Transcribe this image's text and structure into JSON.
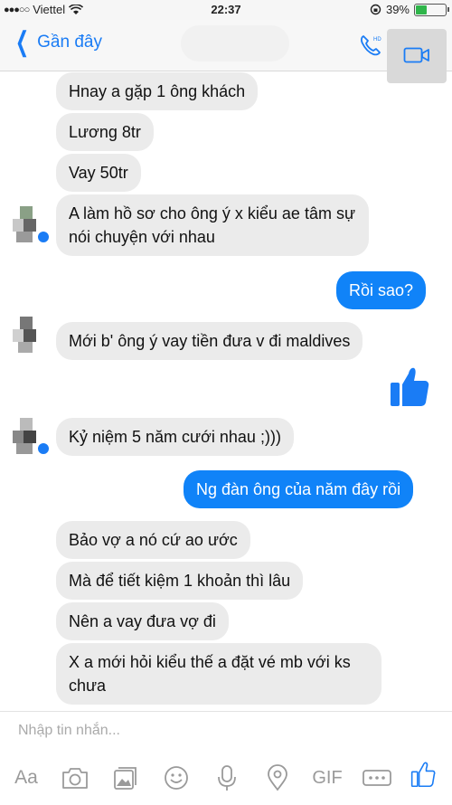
{
  "status_bar": {
    "signal": "●●●○○",
    "carrier": "Viettel",
    "time": "22:37",
    "battery_percent": "39%",
    "battery_level": 0.39
  },
  "nav": {
    "back_label": "Gần đây"
  },
  "messages": [
    {
      "side": "in",
      "text": "Hnay a gặp 1 ông khách"
    },
    {
      "side": "in",
      "text": "Lương 8tr"
    },
    {
      "side": "in",
      "text": "Vay 50tr"
    },
    {
      "side": "in",
      "text": "A làm hồ sơ cho ông ý x kiểu ae tâm sự nói chuyện với nhau"
    },
    {
      "side": "out",
      "text": "Rồi sao?"
    },
    {
      "side": "in",
      "text": "Mới b' ông ý vay tiền đưa v đi maldives"
    },
    {
      "side": "out",
      "text": "like"
    },
    {
      "side": "in",
      "text": "Kỷ niệm 5 năm cưới nhau ;)))"
    },
    {
      "side": "out",
      "text": "Ng đàn ông của năm đây rồi"
    },
    {
      "side": "in",
      "text": "Bảo vợ a nó cứ ao ước"
    },
    {
      "side": "in",
      "text": "Mà để tiết kiệm 1 khoản thì lâu"
    },
    {
      "side": "in",
      "text": "Nên a vay đưa vợ đi"
    },
    {
      "side": "in",
      "text": "X a mới hỏi kiểu thế a đặt vé mb với ks chưa"
    }
  ],
  "composer": {
    "placeholder": "Nhập tin nhắn...",
    "text_tool": "Aa",
    "gif_tool": "GIF"
  },
  "colors": {
    "accent": "#1a7cf5",
    "outgoing_bubble": "#1083f8",
    "incoming_bubble": "#ebebeb"
  }
}
